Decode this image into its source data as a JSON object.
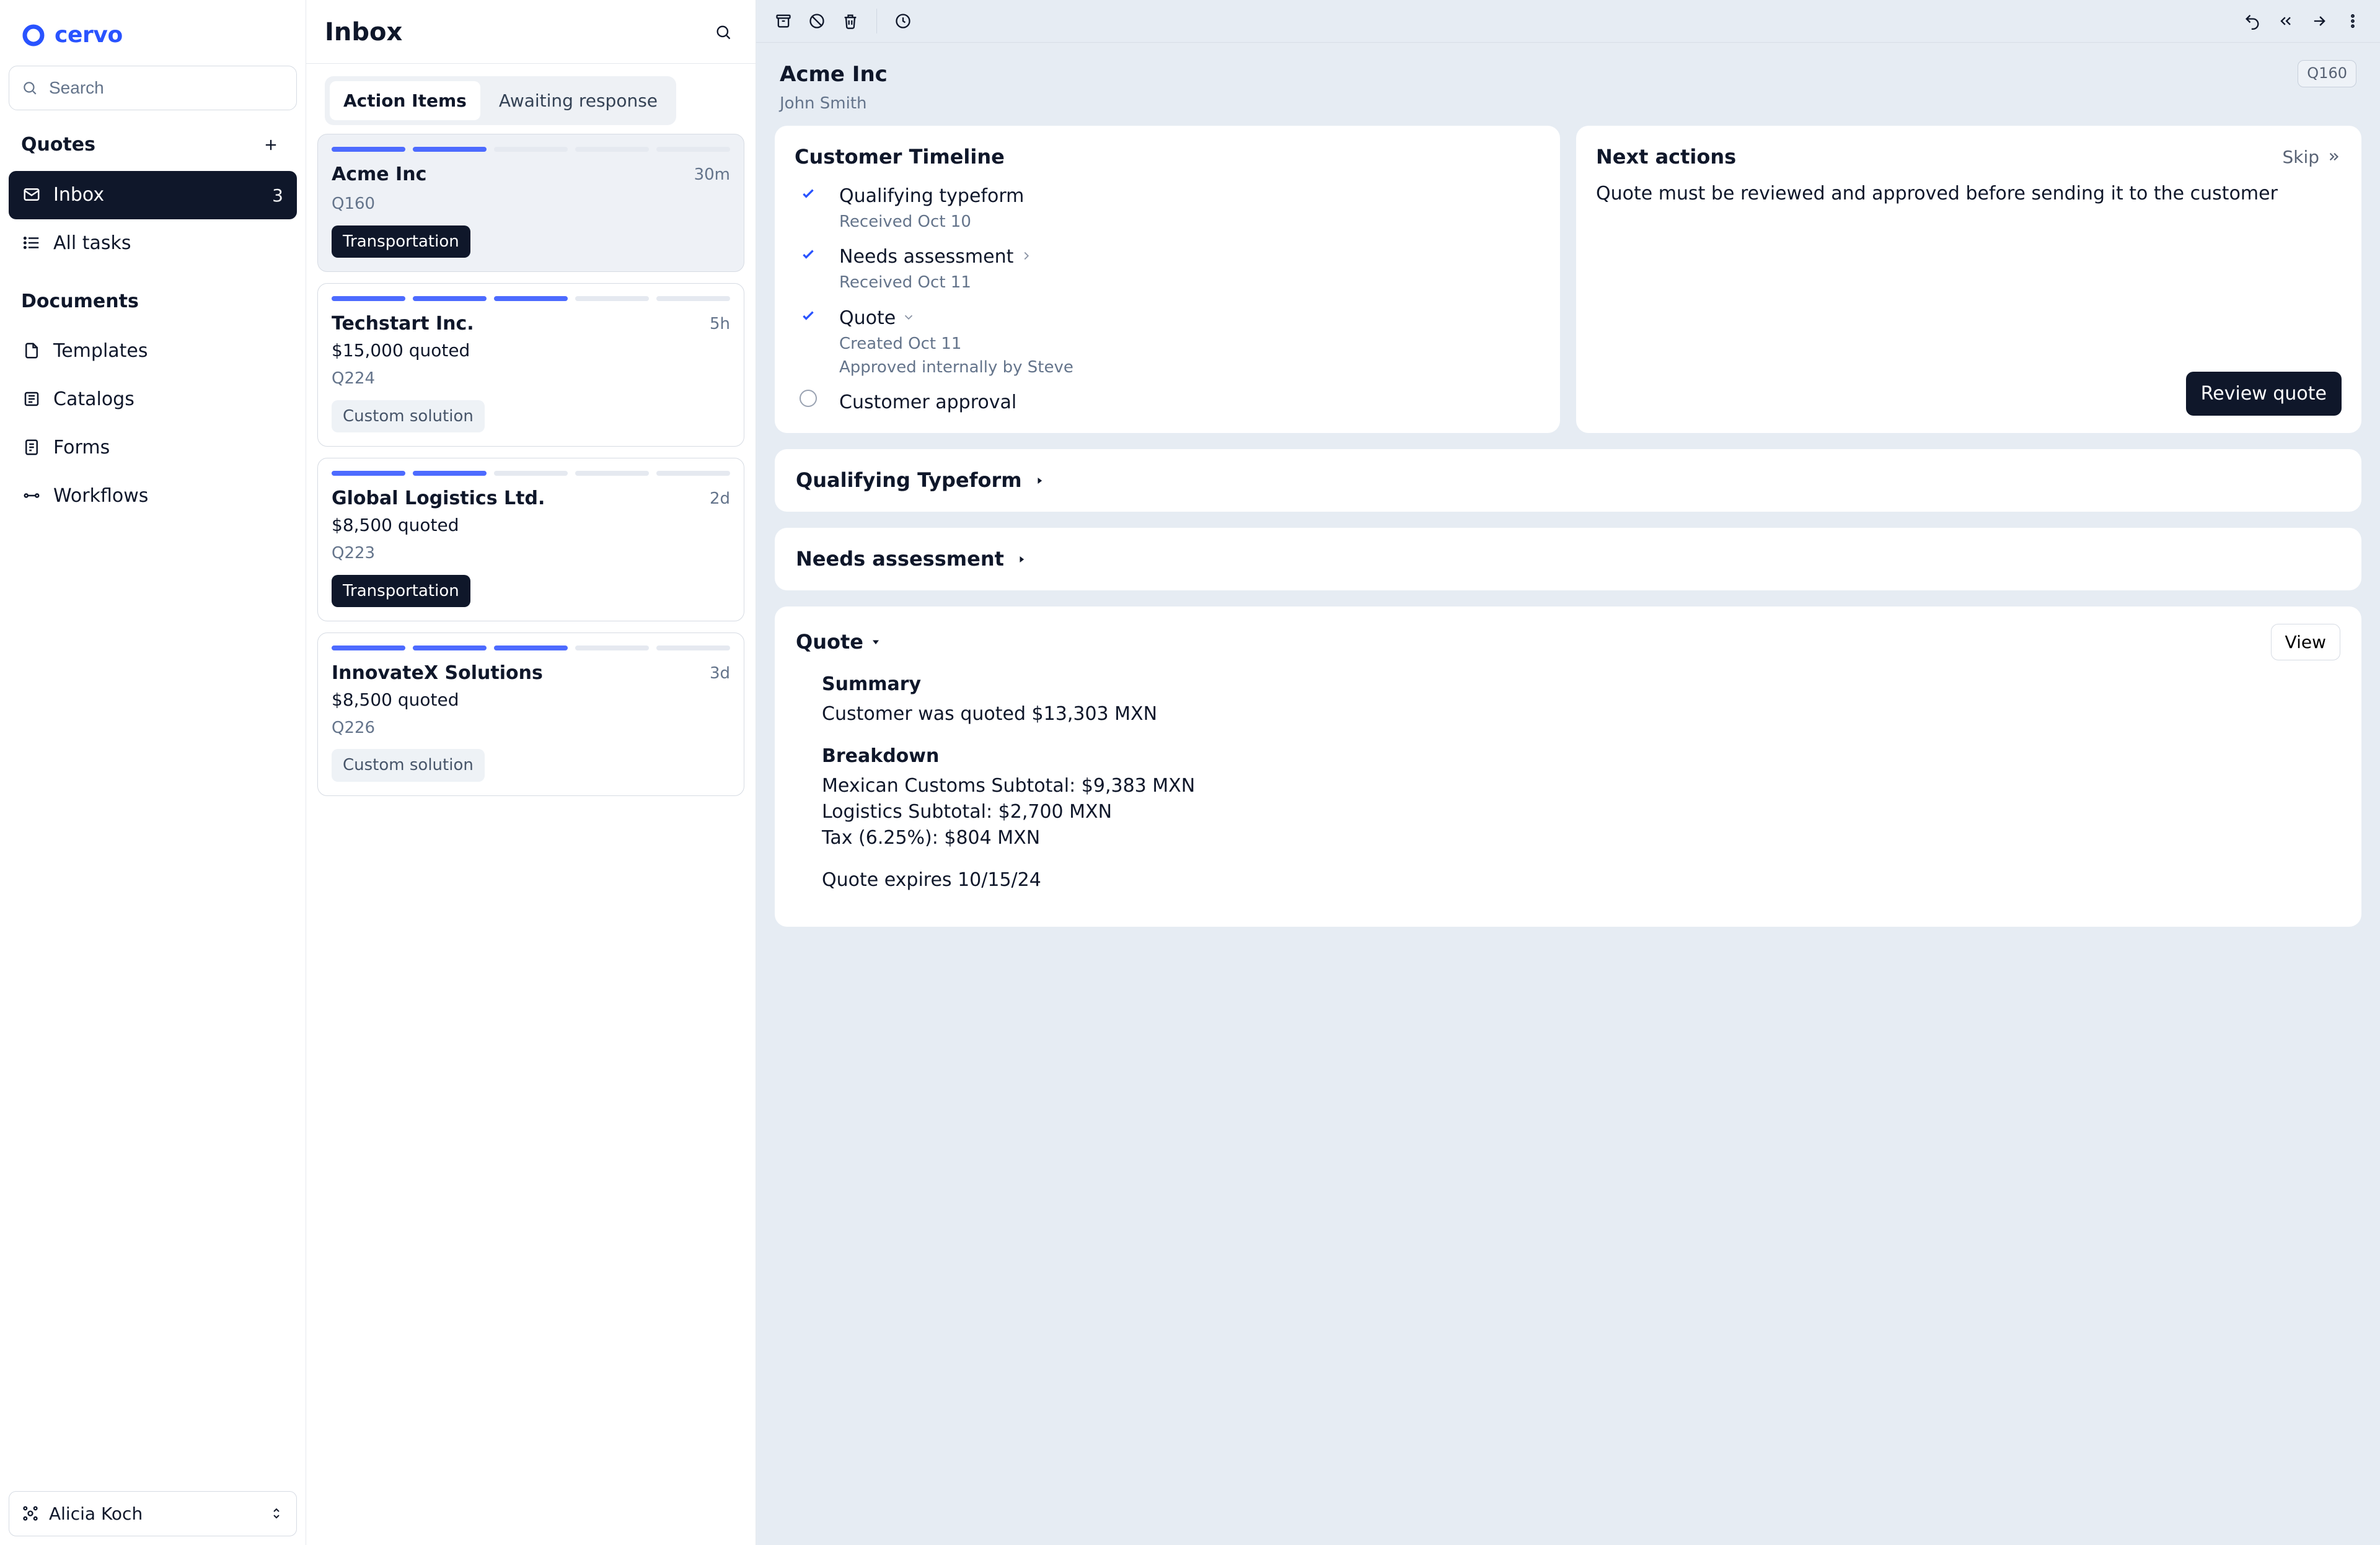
{
  "brand": {
    "name": "cervo"
  },
  "sidebar": {
    "search_placeholder": "Search",
    "sections": {
      "quotes": {
        "label": "Quotes"
      },
      "documents": {
        "label": "Documents"
      }
    },
    "items": [
      {
        "label": "Inbox",
        "badge": "3",
        "active": true
      },
      {
        "label": "All tasks"
      }
    ],
    "docs": [
      {
        "label": "Templates"
      },
      {
        "label": "Catalogs"
      },
      {
        "label": "Forms"
      },
      {
        "label": "Workflows"
      }
    ],
    "user": {
      "name": "Alicia Koch"
    }
  },
  "list": {
    "title": "Inbox",
    "tabs": [
      {
        "label": "Action Items",
        "active": true
      },
      {
        "label": "Awaiting response"
      }
    ],
    "items": [
      {
        "company": "Acme Inc",
        "time": "30m",
        "sub": "",
        "quote_id": "Q160",
        "tag": "Transportation",
        "tag_style": "dark",
        "progress": [
          1,
          1,
          0,
          0,
          0
        ],
        "selected": true
      },
      {
        "company": "Techstart Inc.",
        "time": "5h",
        "sub": "$15,000 quoted",
        "quote_id": "Q224",
        "tag": "Custom solution",
        "tag_style": "soft",
        "progress": [
          1,
          1,
          1,
          0,
          0
        ]
      },
      {
        "company": "Global Logistics Ltd.",
        "time": "2d",
        "sub": "$8,500 quoted",
        "quote_id": "Q223",
        "tag": "Transportation",
        "tag_style": "dark",
        "progress": [
          1,
          1,
          0,
          0,
          0
        ]
      },
      {
        "company": "InnovateX Solutions",
        "time": "3d",
        "sub": "$8,500 quoted",
        "quote_id": "Q226",
        "tag": "Custom solution",
        "tag_style": "soft",
        "progress": [
          1,
          1,
          1,
          0,
          0
        ]
      }
    ]
  },
  "detail": {
    "company": "Acme Inc",
    "contact": "John Smith",
    "quote_id": "Q160",
    "timeline": {
      "title": "Customer Timeline",
      "items": [
        {
          "title": "Qualifying typeform",
          "sub": "Received Oct 10",
          "done": true
        },
        {
          "title": "Needs assessment",
          "sub": "Received Oct 11",
          "done": true,
          "chevron": true
        },
        {
          "title": "Quote",
          "sub": "Created Oct 11",
          "sub2": "Approved internally by Steve",
          "done": true,
          "caret": true
        },
        {
          "title": "Customer approval",
          "done": false
        }
      ]
    },
    "next": {
      "title": "Next actions",
      "skip": "Skip",
      "desc": "Quote must be reviewed and approved before sending it to the customer",
      "cta": "Review quote"
    },
    "accordions": [
      {
        "title": "Qualifying Typeform"
      },
      {
        "title": "Needs assessment"
      }
    ],
    "quote": {
      "title": "Quote",
      "view": "View",
      "summary_label": "Summary",
      "summary": "Customer was quoted $13,303 MXN",
      "breakdown_label": "Breakdown",
      "lines": [
        "Mexican Customs Subtotal: $9,383 MXN",
        "Logistics Subtotal: $2,700 MXN",
        "Tax (6.25%): $804 MXN"
      ],
      "expires": "Quote expires 10/15/24"
    }
  }
}
